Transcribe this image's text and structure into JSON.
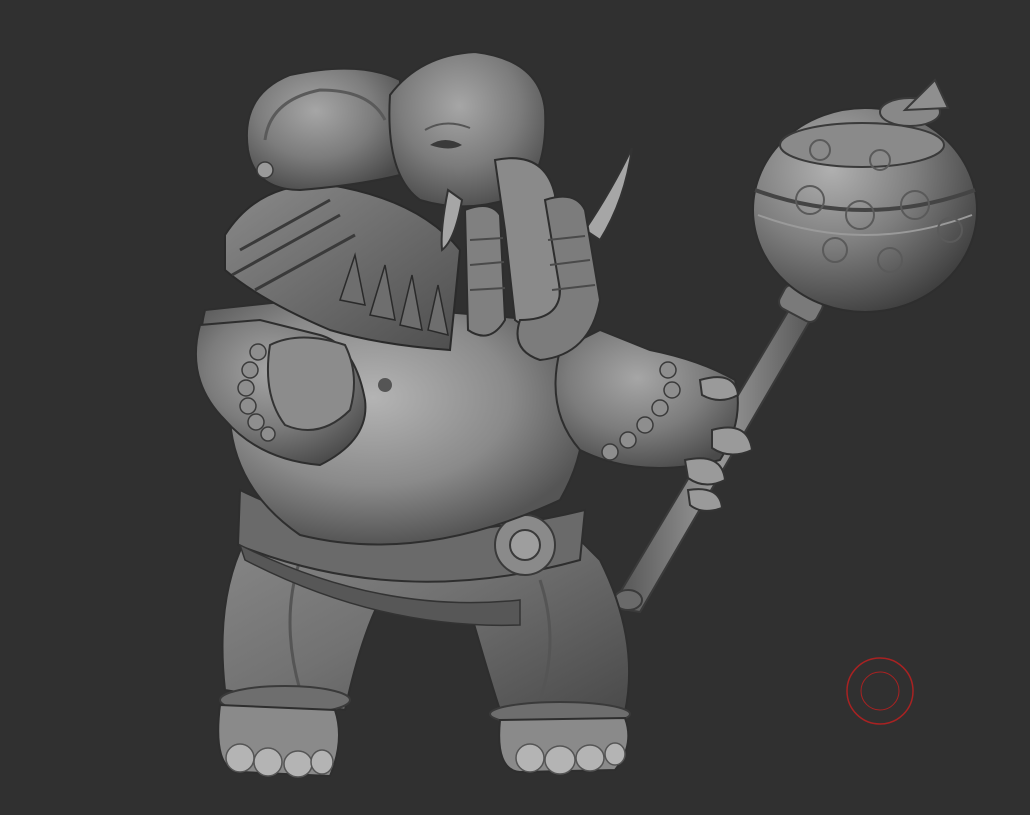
{
  "viewport": {
    "background_color": "#303030",
    "model_color": "#7a7a7a",
    "model_shadow_color": "#3c3c3c",
    "model_highlight_color": "#a8a8a8",
    "subject": "elephant-warrior-sculpt"
  },
  "brush_cursor": {
    "icon": "brush-circle-icon",
    "color": "#a82222"
  }
}
